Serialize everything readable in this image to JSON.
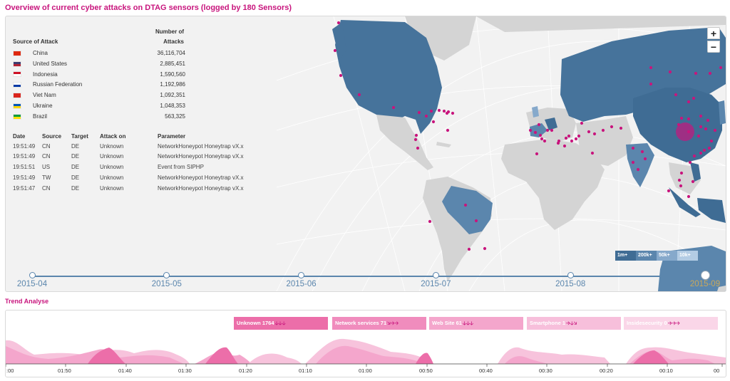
{
  "header": {
    "title": "Overview of current cyber attacks on DTAG sensors (logged by 180 Sensors)"
  },
  "sources_table": {
    "col_source": "Source of Attack",
    "col_attacks_line1": "Number of",
    "col_attacks_line2": "Attacks",
    "rows": [
      {
        "country": "China",
        "attacks": "36,116,704",
        "flag_colors": [
          "#de2910",
          "#de2910"
        ]
      },
      {
        "country": "United States",
        "attacks": "2,885,451",
        "flag_colors": [
          "#3c3b6e",
          "#b22234"
        ]
      },
      {
        "country": "Indonesia",
        "attacks": "1,590,560",
        "flag_colors": [
          "#ce1126",
          "#ffffff"
        ]
      },
      {
        "country": "Russian Federation",
        "attacks": "1,192,986",
        "flag_colors": [
          "#ffffff",
          "#0039a6"
        ]
      },
      {
        "country": "Viet Nam",
        "attacks": "1,092,351",
        "flag_colors": [
          "#da251d",
          "#da251d"
        ]
      },
      {
        "country": "Ukraine",
        "attacks": "1,048,353",
        "flag_colors": [
          "#0057b7",
          "#ffd700"
        ]
      },
      {
        "country": "Brazil",
        "attacks": "563,325",
        "flag_colors": [
          "#009c3b",
          "#ffdf00"
        ]
      }
    ]
  },
  "log_table": {
    "headers": {
      "date": "Date",
      "source": "Source",
      "target": "Target",
      "attack": "Attack on",
      "param": "Parameter"
    },
    "rows": [
      {
        "date": "19:51:49",
        "source": "CN",
        "target": "DE",
        "attack": "Unknown",
        "param": "NetworkHoneypot Honeytrap vX.x"
      },
      {
        "date": "19:51:49",
        "source": "CN",
        "target": "DE",
        "attack": "Unknown",
        "param": "NetworkHoneypot Honeytrap vX.x"
      },
      {
        "date": "19:51:51",
        "source": "US",
        "target": "DE",
        "attack": "Unknown",
        "param": "Event from SIPHP"
      },
      {
        "date": "19:51:49",
        "source": "TW",
        "target": "DE",
        "attack": "Unknown",
        "param": "NetworkHoneypot Honeytrap vX.x"
      },
      {
        "date": "19:51:47",
        "source": "CN",
        "target": "DE",
        "attack": "Unknown",
        "param": "NetworkHoneypot Honeytrap vX.x"
      }
    ]
  },
  "map_controls": {
    "zoom_in": "+",
    "zoom_out": "−"
  },
  "map_legend": [
    {
      "label": "1m+",
      "color": "#3f6c94"
    },
    {
      "label": "200k+",
      "color": "#5b86ad"
    },
    {
      "label": "50k+",
      "color": "#86a9cb"
    },
    {
      "label": "10k+",
      "color": "#b3cce4"
    }
  ],
  "timeline": {
    "months": [
      "2015-04",
      "2015-05",
      "2015-06",
      "2015-07",
      "2015-08",
      "2015-09"
    ],
    "active": "2015-09"
  },
  "trend": {
    "title": "Trend Analyse",
    "categories": [
      {
        "label": "Unknown 1764",
        "arrows": "🡣🡣🡣",
        "color": "#ec6ea9"
      },
      {
        "label": "Network services 71",
        "arrows": "🡦🡢🡢",
        "color": "#f08cbd"
      },
      {
        "label": "Web Site 61",
        "arrows": "🡣🡣🡣",
        "color": "#f4a6cc"
      },
      {
        "label": "Smartphone 1",
        "arrows": "🡢🡣🡦",
        "color": "#f7bfdb"
      },
      {
        "label": "Insidesecurity 0",
        "arrows": "🡢🡢🡢",
        "color": "#fad6e8"
      }
    ],
    "x_ticks": [
      ":00",
      "01:50",
      "01:40",
      "01:30",
      "01:20",
      "01:10",
      "01:00",
      "00:50",
      "00:40",
      "00:30",
      "00:20",
      "00:10",
      "00"
    ]
  },
  "colors": {
    "accent": "#c8157d",
    "land": "#d4d4d4",
    "high": "#3f6c94",
    "mid": "#5b86ad",
    "low": "#86a9cb",
    "point": "#c8157d"
  }
}
